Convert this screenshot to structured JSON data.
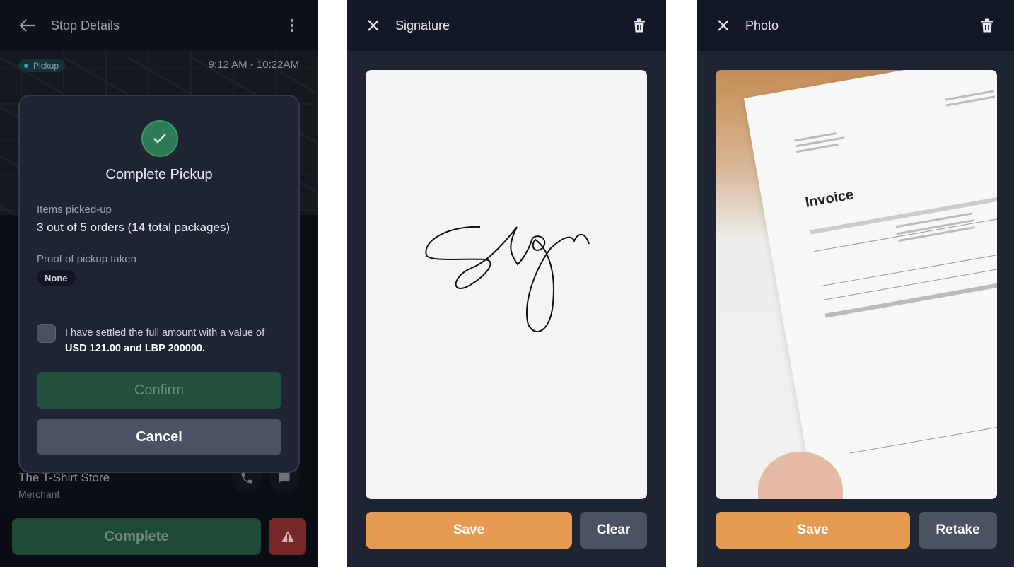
{
  "stop_details": {
    "title": "Stop Details",
    "badge": "Pickup",
    "time_window": "9:12 AM - 10:22AM",
    "merchant_name": "The T-Shirt Store",
    "merchant_role": "Merchant",
    "complete_label": "Complete",
    "modal": {
      "title": "Complete Pickup",
      "items_label": "Items picked-up",
      "items_value": "3 out of 5 orders (14 total packages)",
      "proof_label": "Proof of pickup taken",
      "proof_value": "None",
      "settle_text_prefix": "I have settled the full amount with a value of ",
      "settle_amount": "USD 121.00 and LBP 200000",
      "settle_text_suffix": ".",
      "checkbox_checked": false,
      "confirm_label": "Confirm",
      "cancel_label": "Cancel"
    }
  },
  "signature": {
    "title": "Signature",
    "save_label": "Save",
    "clear_label": "Clear"
  },
  "photo": {
    "title": "Photo",
    "document_heading": "Invoice",
    "save_label": "Save",
    "retake_label": "Retake"
  },
  "colors": {
    "accent": "#e59b52",
    "success": "#2e7a55",
    "danger": "#762826"
  }
}
